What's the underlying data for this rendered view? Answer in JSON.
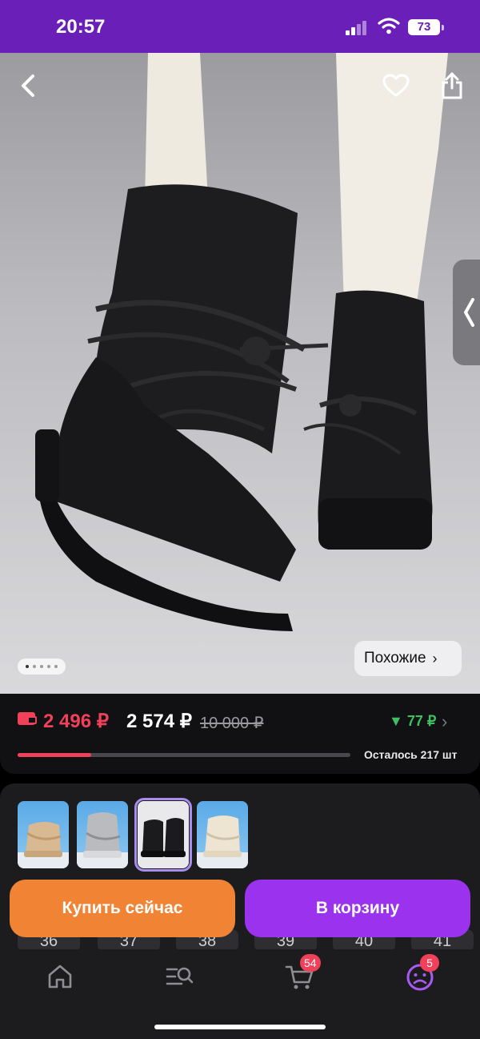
{
  "status_bar": {
    "time": "20:57",
    "battery": "73"
  },
  "hero": {
    "similar_label": "Похожие",
    "image_count": 5,
    "active_image_index": 0
  },
  "price": {
    "wallet_price": "2 496 ₽",
    "price": "2 574 ₽",
    "old_price": "10 000 ₽",
    "cashback": "▼ 77 ₽",
    "stock_progress_fraction": 0.22,
    "stock_label": "Осталось 217 шт"
  },
  "variants": [
    {
      "color": "beige"
    },
    {
      "color": "grey"
    },
    {
      "color": "black",
      "selected": true
    },
    {
      "color": "cream"
    }
  ],
  "sizes": [
    "36",
    "37",
    "38",
    "39",
    "40",
    "41"
  ],
  "actions": {
    "buy_now_label": "Купить сейчас",
    "to_cart_label": "В корзину"
  },
  "tabbar": {
    "cart_badge": "54",
    "profile_badge": "5"
  },
  "colors": {
    "accent_purple": "#9b33ee",
    "status_bar": "#6a1fb8",
    "buy_now_orange": "#f08434",
    "price_red": "#f0405a",
    "cashback_green": "#3fbf5f"
  }
}
